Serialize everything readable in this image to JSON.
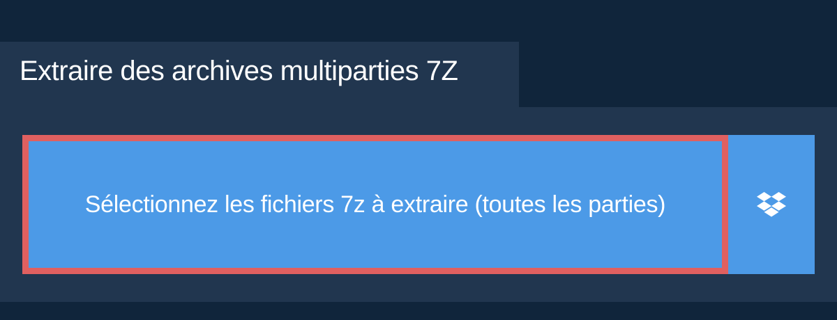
{
  "header": {
    "title": "Extraire des archives multiparties 7Z"
  },
  "upload": {
    "select_label": "Sélectionnez les fichiers 7z à extraire (toutes les parties)",
    "dropbox_icon": "dropbox-icon"
  },
  "colors": {
    "page_background": "#10253b",
    "panel_background": "#21364f",
    "button_blue": "#4c9ae7",
    "highlight_border": "#e06060",
    "text": "#ffffff"
  }
}
